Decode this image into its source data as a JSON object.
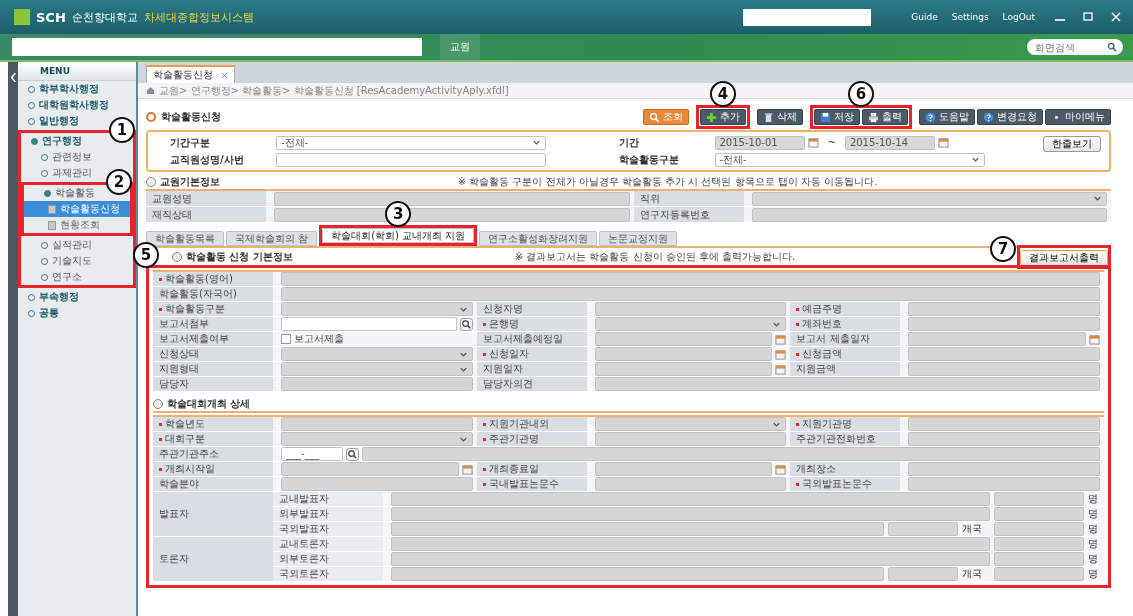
{
  "window": {
    "logo": "SCH",
    "school": "순천향대학교",
    "system": "차세대종합정보시스템",
    "links": [
      "Guide",
      "Settings",
      "LogOut"
    ]
  },
  "navbar": {
    "role": "교원",
    "search_placeholder": "화면검색"
  },
  "menu": {
    "title": "MENU",
    "items": [
      {
        "label": "학부학사행정",
        "selected": false,
        "expanded": false
      },
      {
        "label": "대학원학사행정",
        "selected": false,
        "expanded": false
      },
      {
        "label": "일반행정",
        "selected": false,
        "expanded": false
      },
      {
        "label": "연구행정",
        "selected": false,
        "expanded": true,
        "callout": "1",
        "children": [
          {
            "label": "관련정보",
            "selected": false,
            "expanded": false
          },
          {
            "label": "과제관리",
            "selected": false,
            "expanded": false
          },
          {
            "label": "학술활동",
            "selected": false,
            "expanded": true,
            "callout": "2",
            "children": [
              {
                "label": "학술활동신청",
                "selected": true
              },
              {
                "label": "현황조회",
                "selected": false
              }
            ]
          },
          {
            "label": "실적관리",
            "selected": false,
            "expanded": false
          },
          {
            "label": "기술지도",
            "selected": false,
            "expanded": false
          },
          {
            "label": "연구소",
            "selected": false,
            "expanded": false
          }
        ]
      },
      {
        "label": "부속행정",
        "selected": false,
        "expanded": false
      },
      {
        "label": "공통",
        "selected": false,
        "expanded": false
      }
    ]
  },
  "page_tabs": [
    {
      "label": "학술활동신청",
      "selected": true
    }
  ],
  "breadcrumb": "교원> 연구행정> 학술활동> 학술활동신청 [ResAcademyActivityAply.xfdl]",
  "page_title": "학술활동신청",
  "toolbar": [
    {
      "buttons": [
        {
          "label": "조회",
          "kind": "search"
        }
      ]
    },
    {
      "callout": "4",
      "buttons": [
        {
          "label": "추가",
          "kind": "add"
        }
      ]
    },
    {
      "buttons": [
        {
          "label": "삭제",
          "kind": "delete"
        }
      ]
    },
    {
      "callout": "6",
      "buttons": [
        {
          "label": "저장",
          "kind": "save"
        },
        {
          "label": "출력",
          "kind": "print"
        }
      ]
    },
    {
      "buttons": [
        {
          "label": "도움말",
          "kind": "help"
        },
        {
          "label": "변경요청",
          "kind": "help"
        },
        {
          "label": "마이메뉴",
          "kind": "menu"
        }
      ]
    }
  ],
  "search": {
    "rows": [
      [
        {
          "label": "기간구분",
          "kind": "select",
          "value": "-전체-"
        },
        {
          "label": "기간",
          "kind": "daterange",
          "from": "2015-10-01",
          "separator": "~",
          "to": "2015-10-14"
        }
      ],
      [
        {
          "label": "교직원성명/사번",
          "kind": "text"
        },
        {
          "label": "학술활동구분",
          "kind": "select",
          "value": "-전체-"
        }
      ]
    ],
    "button": "한줄보기"
  },
  "basic_info": {
    "title": "교원기본정보",
    "notice": "※ 학술활동 구분이 전체가 아닐경우 학술활동 추가 시 선택된 항목으로 탭이 자동 이동됩니다.",
    "rows": [
      [
        {
          "label": "교원성명",
          "kind": "text"
        },
        {
          "label": "직위",
          "kind": "select"
        }
      ],
      [
        {
          "label": "재직상태",
          "kind": "text"
        },
        {
          "label": "연구자등록번호",
          "kind": "text"
        }
      ]
    ]
  },
  "sub_tabs": [
    {
      "label": "학술활동목록",
      "selected": false
    },
    {
      "label": "국제학술회의 참",
      "selected": false
    },
    {
      "label": "학술대회(학회) 교내개최 지원",
      "selected": true,
      "callout": "3"
    },
    {
      "label": "연구소활성화장려지원",
      "selected": false
    },
    {
      "label": "논문교정지원",
      "selected": false
    }
  ],
  "application": {
    "title": "학술활동 신청 기본정보",
    "notice": "※ 결과보고서는 학술활동 신청이 승인된 후에 출력가능합니다.",
    "button": {
      "label": "결과보고서출력",
      "callout": "7"
    },
    "callout": "5",
    "rows": [
      [
        {
          "label": "학술활동(영어)",
          "required": true,
          "kind": "text"
        }
      ],
      [
        {
          "label": "학술활동(자국어)",
          "required": false,
          "kind": "text"
        }
      ],
      [
        {
          "label": "학술활동구분",
          "required": true,
          "kind": "select"
        },
        {
          "label": "신청자명",
          "required": false,
          "kind": "text"
        },
        {
          "label": "예금주명",
          "required": true,
          "kind": "text"
        }
      ],
      [
        {
          "label": "보고서첨부",
          "required": false,
          "kind": "search"
        },
        {
          "label": "은행명",
          "required": true,
          "kind": "select"
        },
        {
          "label": "계좌번호",
          "required": true,
          "kind": "text"
        }
      ],
      [
        {
          "label": "보고서제출여부",
          "required": false,
          "kind": "checkbox",
          "option": "보고서제출",
          "checked": false
        },
        {
          "label": "보고서제출예정일",
          "required": false,
          "kind": "date"
        },
        {
          "label": "보고서 제출일자",
          "required": false,
          "kind": "date"
        }
      ],
      [
        {
          "label": "신청상태",
          "required": false,
          "kind": "select"
        },
        {
          "label": "신청일자",
          "required": true,
          "kind": "date"
        },
        {
          "label": "신청금액",
          "required": true,
          "kind": "text"
        }
      ],
      [
        {
          "label": "지원형태",
          "required": false,
          "kind": "select"
        },
        {
          "label": "지원일자",
          "required": false,
          "kind": "date"
        },
        {
          "label": "지원금액",
          "required": false,
          "kind": "text"
        }
      ],
      [
        {
          "label": "담당자",
          "required": false,
          "kind": "text"
        },
        {
          "label": "담당자의견",
          "required": false,
          "kind": "text"
        }
      ]
    ]
  },
  "detail": {
    "title": "학술대회개최 상세",
    "rows": [
      [
        {
          "label": "학술년도",
          "required": true,
          "kind": "text"
        },
        {
          "label": "지원기관내외",
          "required": true,
          "kind": "select"
        },
        {
          "label": "지원기관명",
          "required": true,
          "kind": "text"
        }
      ],
      [
        {
          "label": "대회구분",
          "required": true,
          "kind": "select"
        },
        {
          "label": "주관기관명",
          "required": true,
          "kind": "text"
        },
        {
          "label": "주관기관전화번호",
          "required": false,
          "kind": "text"
        }
      ],
      [
        {
          "label": "주관기관주소",
          "required": false,
          "kind": "address",
          "value": "___-___"
        }
      ],
      [
        {
          "label": "개최시작일",
          "required": true,
          "kind": "date"
        },
        {
          "label": "개최종료일",
          "required": true,
          "kind": "date"
        },
        {
          "label": "개최장소",
          "required": false,
          "kind": "text"
        }
      ],
      [
        {
          "label": "학술분야",
          "required": false,
          "kind": "text"
        },
        {
          "label": "국내발표논문수",
          "required": true,
          "kind": "text"
        },
        {
          "label": "국외발표논문수",
          "required": true,
          "kind": "text"
        }
      ]
    ],
    "participants": [
      {
        "label": "발표자",
        "rows": [
          {
            "label": "교내발표자",
            "unit": "명"
          },
          {
            "label": "외부발표자",
            "unit": "명"
          },
          {
            "label": "국외발표자",
            "country_unit": "개국",
            "unit": "명"
          }
        ]
      },
      {
        "label": "토론자",
        "rows": [
          {
            "label": "교내토론자",
            "unit": "명"
          },
          {
            "label": "외부토론자",
            "unit": "명"
          },
          {
            "label": "국외토론자",
            "country_unit": "개국",
            "unit": "명"
          }
        ]
      }
    ]
  }
}
